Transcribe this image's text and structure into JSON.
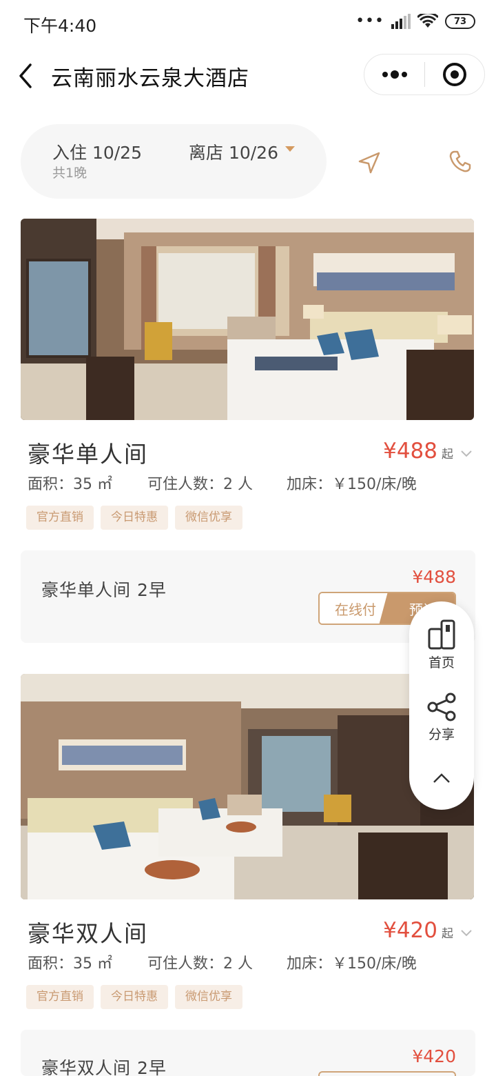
{
  "status_bar": {
    "time": "下午4:40",
    "battery": "73"
  },
  "nav": {
    "title": "云南丽水云泉大酒店"
  },
  "dates": {
    "checkin": "入住 10/25",
    "nights": "共1晚",
    "checkout": "离店 10/26"
  },
  "rooms": [
    {
      "name": "豪华单人间",
      "price": "¥488",
      "price_suffix": "起",
      "area": "面积：35 ㎡",
      "occupancy": "可住人数：2 人",
      "extra_bed": "加床：￥150/床/晚",
      "tags": [
        "官方直销",
        "今日特惠",
        "微信优享"
      ],
      "package": {
        "name": "豪华单人间  2早",
        "price": "¥488",
        "pay_label": "在线付",
        "book_label": "预订"
      }
    },
    {
      "name": "豪华双人间",
      "price": "¥420",
      "price_suffix": "起",
      "area": "面积：35 ㎡",
      "occupancy": "可住人数：2 人",
      "extra_bed": "加床：￥150/床/晚",
      "tags": [
        "官方直销",
        "今日特惠",
        "微信优享"
      ],
      "package": {
        "name": "豪华双人间  2早",
        "price": "¥420"
      }
    }
  ],
  "float_menu": {
    "home": "首页",
    "share": "分享"
  },
  "colors": {
    "price": "#e24f3e",
    "accent": "#c9996c",
    "tag_bg": "#f7eee6"
  }
}
